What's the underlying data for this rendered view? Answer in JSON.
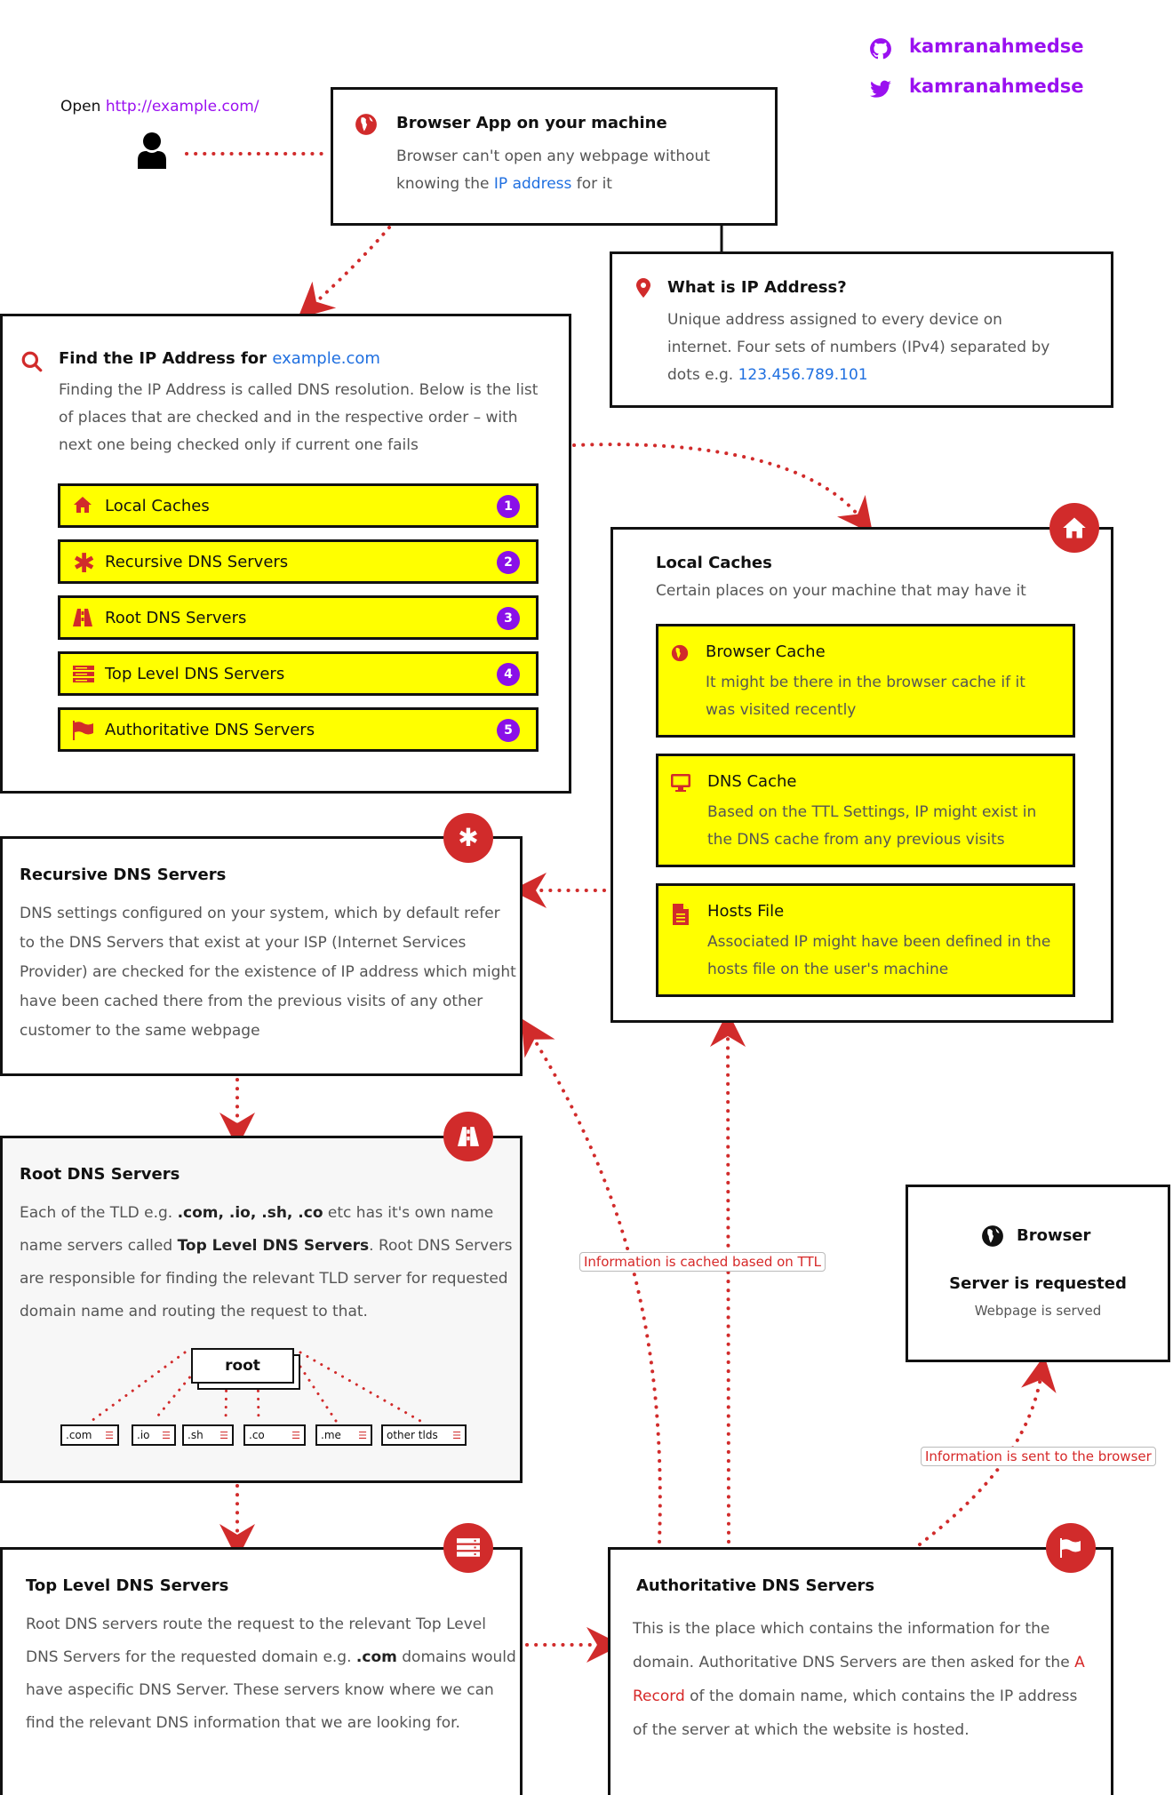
{
  "social": {
    "github": {
      "icon": "github-icon",
      "handle": "kamranahmedse"
    },
    "twitter": {
      "icon": "twitter-icon",
      "handle": "kamranahmedse"
    }
  },
  "user": {
    "open_label": "Open",
    "url": "http://example.com/",
    "icon": "user-icon"
  },
  "browser_app": {
    "icon": "globe-icon",
    "title": "Browser App on your machine",
    "desc_before": "Browser can't open any webpage without knowing the",
    "desc_link": "IP address",
    "desc_after": "for it"
  },
  "ip_info": {
    "icon": "map-marker-icon",
    "title": "What is IP Address?",
    "desc": "Unique address assigned to every device on internet. Four sets of numbers (IPv4) separated by dots e.g.",
    "example_ip": "123.456.789.101"
  },
  "find_ip": {
    "icon": "search-icon",
    "title_prefix": "Find the IP Address for",
    "domain": "example.com",
    "desc": "Finding the IP Address is called DNS resolution. Below is the list of places that are checked and in the respective order – with next one being checked only if current one fails",
    "steps": [
      {
        "icon": "home-icon",
        "label": "Local Caches",
        "num": "1"
      },
      {
        "icon": "asterisk-icon",
        "label": "Recursive DNS Servers",
        "num": "2"
      },
      {
        "icon": "road-icon",
        "label": "Root DNS Servers",
        "num": "3"
      },
      {
        "icon": "server-icon",
        "label": "Top Level DNS Servers",
        "num": "4"
      },
      {
        "icon": "flag-icon",
        "label": "Authoritative DNS Servers",
        "num": "5"
      }
    ]
  },
  "local_caches": {
    "badge_icon": "home-icon",
    "title": "Local Caches",
    "desc": "Certain places on your machine that may have it",
    "items": [
      {
        "icon": "globe-icon",
        "title": "Browser Cache",
        "desc": "It might be there in the browser cache if it was visited recently"
      },
      {
        "icon": "monitor-icon",
        "title": "DNS Cache",
        "desc": "Based on the TTL Settings, IP might exist in the DNS cache from any previous visits"
      },
      {
        "icon": "file-icon",
        "title": "Hosts File",
        "desc": "Associated IP might have been defined in the hosts file on the user's machine"
      }
    ]
  },
  "recursive": {
    "badge_icon": "asterisk-icon",
    "title": "Recursive DNS Servers",
    "desc": "DNS settings configured on your system, which by default refer to the DNS Servers that exist at your ISP (Internet Services Provider) are checked for the existence of IP address which might have been cached there from the previous visits of any other customer to the same webpage"
  },
  "root": {
    "badge_icon": "road-icon",
    "title": "Root DNS Servers",
    "desc_1": "Each of the TLD e.g.",
    "desc_bold_1": ".com, .io, .sh, .co",
    "desc_2": "etc has it's own name name servers called",
    "desc_bold_2": "Top Level DNS Servers",
    "desc_3": ". Root DNS Servers are responsible for finding the relevant TLD server for requested domain name and routing the request to that.",
    "tree_root": "root",
    "tlds": [
      ".com",
      ".io",
      ".sh",
      ".co",
      ".me",
      "other tlds"
    ]
  },
  "tld": {
    "badge_icon": "server-icon",
    "title": "Top Level DNS Servers",
    "desc_1": "Root DNS servers route the request to the relevant Top Level DNS Servers for the requested domain e.g.",
    "desc_bold": ".com",
    "desc_2": "domains would have aspecific DNS Server. These servers know where we can find the relevant DNS information that we are looking for."
  },
  "authoritative": {
    "badge_icon": "flag-icon",
    "title": "Authoritative DNS Servers",
    "desc_1": "This is the place which contains the information for the domain. Authoritative DNS Servers are then asked for the",
    "desc_link": "A Record",
    "desc_2": "of the domain name, which contains the IP address of the server at which the website is hosted."
  },
  "browser_final": {
    "icon": "globe-icon",
    "label": "Browser",
    "title": "Server is requested",
    "subtitle": "Webpage is served"
  },
  "captions": {
    "cached": "Information is cached based on TTL",
    "sent": "Information is sent to the browser"
  },
  "colors": {
    "accent_red": "#d12b2b",
    "highlight_yellow": "#ffff00",
    "link_blue": "#1f6fe0",
    "purple": "#9a10f0"
  }
}
